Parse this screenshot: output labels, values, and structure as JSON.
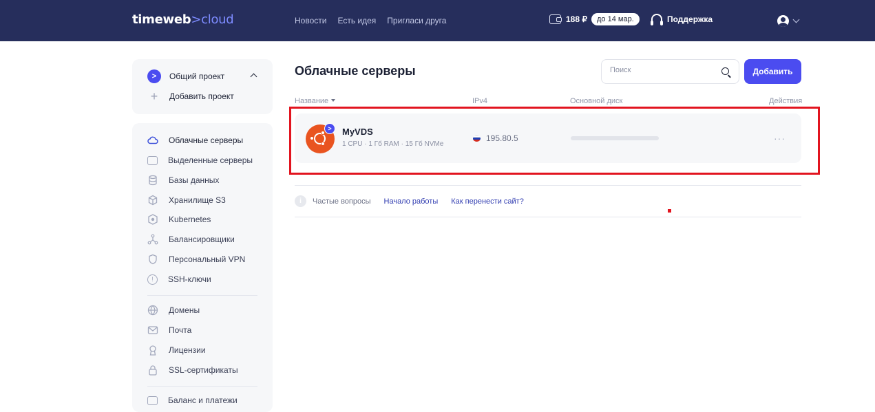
{
  "header": {
    "logo_main": "timeweb",
    "logo_accent": ">cloud",
    "nav": [
      "Новости",
      "Есть идея",
      "Пригласи друга"
    ],
    "balance": "188 ₽",
    "balance_until": "до 14 мар.",
    "support_label": "Поддержка"
  },
  "sidebar": {
    "project": {
      "badge": ">",
      "current": "Общий проект",
      "add": "Добавить проект"
    },
    "items": [
      {
        "label": "Облачные серверы",
        "icon": "cloud-icon"
      },
      {
        "label": "Выделенные серверы",
        "icon": "server-icon"
      },
      {
        "label": "Базы данных",
        "icon": "database-icon"
      },
      {
        "label": "Хранилище S3",
        "icon": "cube-icon"
      },
      {
        "label": "Kubernetes",
        "icon": "kubernetes-icon"
      },
      {
        "label": "Балансировщики",
        "icon": "balancer-icon"
      },
      {
        "label": "Персональный VPN",
        "icon": "shield-icon"
      },
      {
        "label": "SSH-ключи",
        "icon": "key-icon"
      },
      {
        "label": "Домены",
        "icon": "globe-icon"
      },
      {
        "label": "Почта",
        "icon": "mail-icon"
      },
      {
        "label": "Лицензии",
        "icon": "license-icon"
      },
      {
        "label": "SSL-сертификаты",
        "icon": "lock-icon"
      },
      {
        "label": "Баланс и платежи",
        "icon": "wallet-icon"
      }
    ]
  },
  "main": {
    "title": "Облачные серверы",
    "search_placeholder": "Поиск",
    "add_button": "Добавить",
    "columns": {
      "name": "Название",
      "ipv4": "IPv4",
      "disk": "Основной диск",
      "actions": "Действия"
    },
    "servers": [
      {
        "name": "MyVDS",
        "spec": "1 CPU · 1 Гб RAM · 15 Гб NVMe",
        "os_icon": "ubuntu-icon",
        "project_badge": ">",
        "country_flag": "russia-flag-icon",
        "ipv4": "195.80.5",
        "actions": "···"
      }
    ],
    "faq": {
      "info_icon": "i",
      "label": "Частые вопросы",
      "links": [
        "Начало работы",
        "Как перенести сайт?"
      ]
    }
  },
  "colors": {
    "header_bg": "#262e5c",
    "accent": "#4b4cf0",
    "highlight": "#e2141f",
    "ubuntu": "#e95420"
  }
}
